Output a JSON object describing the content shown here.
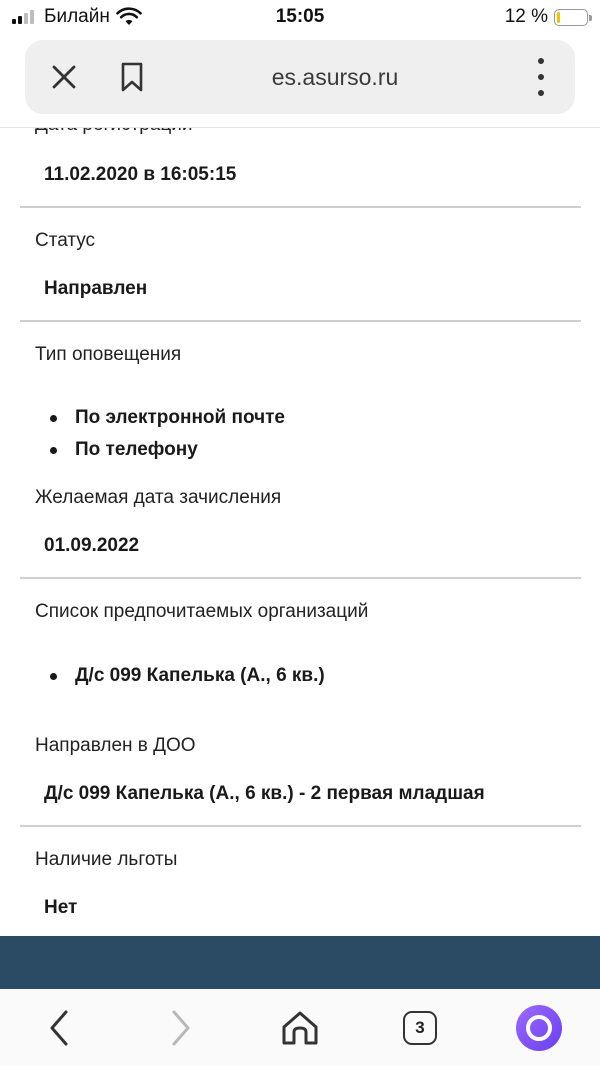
{
  "status_bar": {
    "carrier": "Билайн",
    "time": "15:05",
    "battery_percent": "12 %",
    "battery_level": 0.12,
    "battery_color": "#f5c400"
  },
  "browser": {
    "url": "es.asurso.ru",
    "icons": [
      "close-icon",
      "bookmark-icon",
      "more-vertical-icon"
    ]
  },
  "fields": {
    "registration_date": {
      "label": "Дата регистрации",
      "value": "11.02.2020 в 16:05:15"
    },
    "status": {
      "label": "Статус",
      "value": "Направлен"
    },
    "notification_type": {
      "label": "Тип оповещения",
      "items": [
        "По электронной почте",
        "По телефону"
      ]
    },
    "desired_date": {
      "label": "Желаемая дата зачисления",
      "value": "01.09.2022"
    },
    "preferred_orgs": {
      "label": "Список предпочитаемых организаций",
      "items": [
        "Д/с 099 Капелька (А., 6 кв.)"
      ]
    },
    "directed_to": {
      "label": "Направлен в ДОО",
      "value": "Д/с 099 Капелька (А., 6 кв.) - 2 первая младшая"
    },
    "benefit": {
      "label": "Наличие льготы",
      "value": "Нет"
    }
  },
  "footer": {
    "color": "#2b4a63"
  },
  "bottom_nav": {
    "tabs_count": "3",
    "icons": [
      "back-icon",
      "forward-icon",
      "home-icon",
      "tabs-icon",
      "alice-assistant-icon"
    ]
  }
}
